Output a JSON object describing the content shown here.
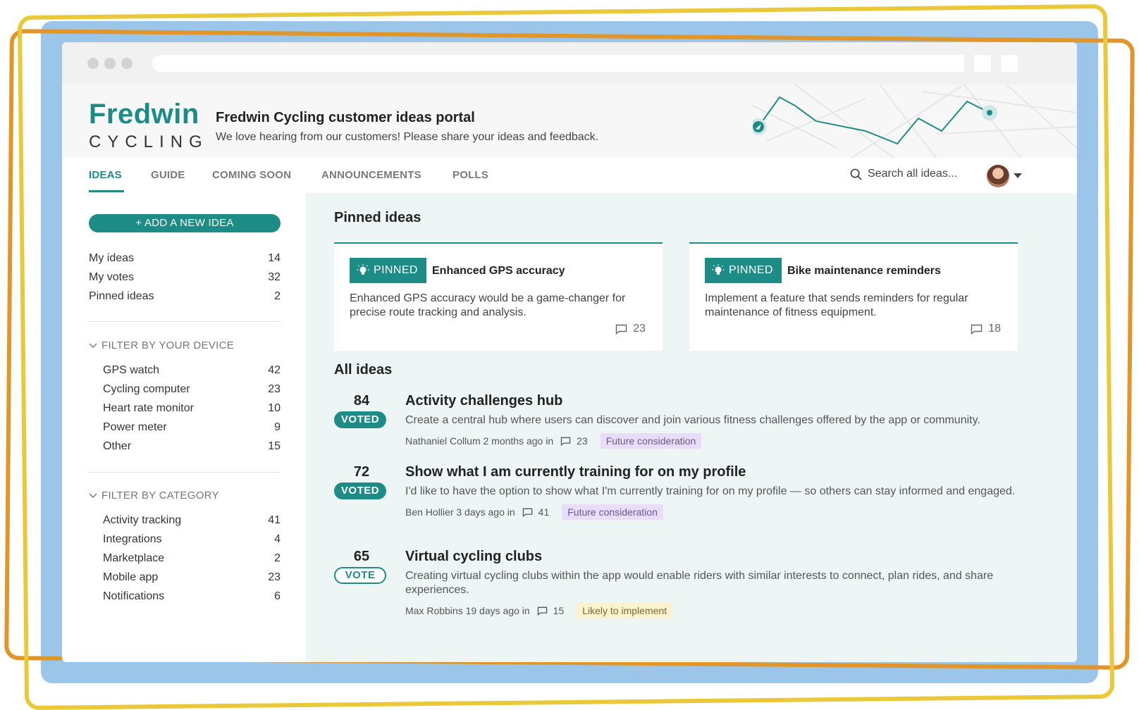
{
  "colors": {
    "accent": "#1e8c86",
    "frame_blue": "#9cc6e9",
    "frame_yellow": "#e9c83a",
    "frame_orange": "#e0962a"
  },
  "logo": {
    "name": "Fredwin",
    "sub": "CYCLING"
  },
  "portal": {
    "title": "Fredwin Cycling customer ideas portal",
    "subtitle": "We love hearing from our customers! Please share your ideas and feedback."
  },
  "nav": {
    "tabs": [
      "IDEAS",
      "GUIDE",
      "COMING SOON",
      "ANNOUNCEMENTS",
      "POLLS"
    ],
    "active_tab": "IDEAS",
    "search_placeholder": "Search all ideas..."
  },
  "sidebar": {
    "add_button": "+ ADD A NEW IDEA",
    "my_items": [
      {
        "label": "My ideas",
        "count": "14"
      },
      {
        "label": "My votes",
        "count": "32"
      },
      {
        "label": "Pinned ideas",
        "count": "2"
      }
    ],
    "device_filter": {
      "title": "FILTER BY YOUR DEVICE",
      "items": [
        {
          "label": "GPS watch",
          "count": "42"
        },
        {
          "label": "Cycling computer",
          "count": "23"
        },
        {
          "label": "Heart rate monitor",
          "count": "10"
        },
        {
          "label": "Power meter",
          "count": "9"
        },
        {
          "label": "Other",
          "count": "15"
        }
      ]
    },
    "category_filter": {
      "title": "FILTER BY CATEGORY",
      "items": [
        {
          "label": "Activity tracking",
          "count": "41"
        },
        {
          "label": "Integrations",
          "count": "4"
        },
        {
          "label": "Marketplace",
          "count": "2"
        },
        {
          "label": "Mobile app",
          "count": "23"
        },
        {
          "label": "Notifications",
          "count": "6"
        }
      ]
    }
  },
  "pinned": {
    "title": "Pinned ideas",
    "badge": "PINNED",
    "cards": [
      {
        "title": "Enhanced GPS accuracy",
        "desc": "Enhanced GPS accuracy would be a game-changer for precise route tracking and analysis.",
        "comments": "23"
      },
      {
        "title": "Bike maintenance reminders",
        "desc": "Implement a feature that sends reminders for regular maintenance of fitness equipment.",
        "comments": "18"
      }
    ]
  },
  "all_ideas": {
    "title": "All ideas",
    "items": [
      {
        "votes": "84",
        "vote_label": "VOTED",
        "title": "Activity challenges hub",
        "desc": "Create a central hub where users can discover and join various fitness challenges offered by the app or community.",
        "meta": "Nathaniel Collum 2 months ago in",
        "comments": "23",
        "status": "Future consideration"
      },
      {
        "votes": "72",
        "vote_label": "VOTED",
        "title": "Show what I am currently training for on my profile",
        "desc": "I'd like to have the option to show what I'm currently training for on my profile — so others can stay informed and engaged.",
        "meta": "Ben Hollier 3 days ago in",
        "comments": "41",
        "status": "Future consideration"
      },
      {
        "votes": "65",
        "vote_label": "VOTE",
        "title": "Virtual cycling clubs",
        "desc": "Creating virtual cycling clubs within the app would enable riders with similar interests to connect, plan rides, and share experiences.",
        "meta": "Max Robbins 19 days ago in",
        "comments": "15",
        "status": "Likely to implement"
      }
    ]
  }
}
